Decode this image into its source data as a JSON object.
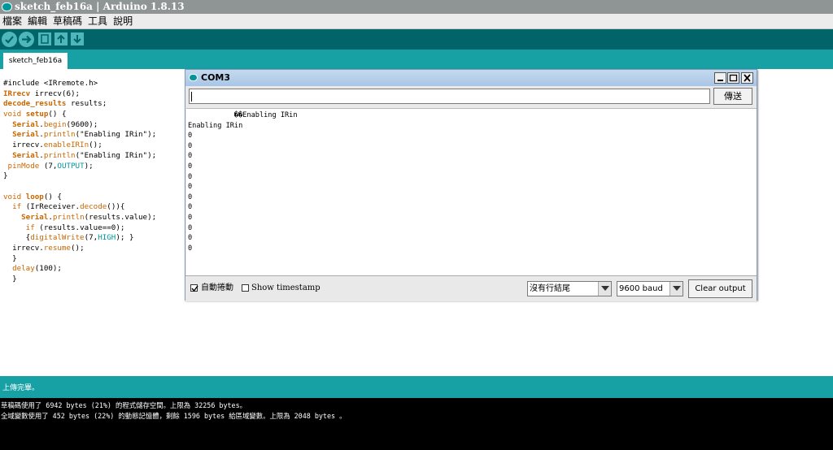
{
  "window": {
    "title": "sketch_feb16a | Arduino 1.8.13"
  },
  "menu": {
    "items": [
      "檔案",
      "編輯",
      "草稿碼",
      "工具",
      "說明"
    ]
  },
  "tab": {
    "label": "sketch_feb16a"
  },
  "code": {
    "lines": [
      [
        {
          "t": "#include <IRremote.h>",
          "c": ""
        }
      ],
      [
        {
          "t": "IRrecv",
          "c": "kwb"
        },
        {
          "t": " irrecv(6);",
          "c": ""
        }
      ],
      [
        {
          "t": "decode_results",
          "c": "kwb"
        },
        {
          "t": " results;",
          "c": ""
        }
      ],
      [
        {
          "t": "void",
          "c": "ty"
        },
        {
          "t": " ",
          "c": ""
        },
        {
          "t": "setup",
          "c": "kwb"
        },
        {
          "t": "() {",
          "c": ""
        }
      ],
      [
        {
          "t": "  ",
          "c": ""
        },
        {
          "t": "Serial",
          "c": "kwb"
        },
        {
          "t": ".",
          "c": ""
        },
        {
          "t": "begin",
          "c": "kw"
        },
        {
          "t": "(9600);",
          "c": ""
        }
      ],
      [
        {
          "t": "  ",
          "c": ""
        },
        {
          "t": "Serial",
          "c": "kwb"
        },
        {
          "t": ".",
          "c": ""
        },
        {
          "t": "println",
          "c": "kw"
        },
        {
          "t": "(\"Enabling IRin\");",
          "c": ""
        }
      ],
      [
        {
          "t": "  irrecv.",
          "c": ""
        },
        {
          "t": "enableIRIn",
          "c": "kw"
        },
        {
          "t": "();",
          "c": ""
        }
      ],
      [
        {
          "t": "  ",
          "c": ""
        },
        {
          "t": "Serial",
          "c": "kwb"
        },
        {
          "t": ".",
          "c": ""
        },
        {
          "t": "println",
          "c": "kw"
        },
        {
          "t": "(\"Enabling IRin\");",
          "c": ""
        }
      ],
      [
        {
          "t": " ",
          "c": ""
        },
        {
          "t": "pinMode",
          "c": "kw"
        },
        {
          "t": " (7,",
          "c": ""
        },
        {
          "t": "OUTPUT",
          "c": "cst"
        },
        {
          "t": ");",
          "c": ""
        }
      ],
      [
        {
          "t": "}",
          "c": ""
        }
      ],
      [
        {
          "t": "",
          "c": ""
        }
      ],
      [
        {
          "t": "void",
          "c": "ty"
        },
        {
          "t": " ",
          "c": ""
        },
        {
          "t": "loop",
          "c": "kwb"
        },
        {
          "t": "() {",
          "c": ""
        }
      ],
      [
        {
          "t": "  ",
          "c": ""
        },
        {
          "t": "if",
          "c": "kw"
        },
        {
          "t": " (IrReceiver.",
          "c": ""
        },
        {
          "t": "decode",
          "c": "kw"
        },
        {
          "t": "()){",
          "c": ""
        }
      ],
      [
        {
          "t": "    ",
          "c": ""
        },
        {
          "t": "Serial",
          "c": "kwb"
        },
        {
          "t": ".",
          "c": ""
        },
        {
          "t": "println",
          "c": "kw"
        },
        {
          "t": "(results.value);",
          "c": ""
        }
      ],
      [
        {
          "t": "     ",
          "c": ""
        },
        {
          "t": "if",
          "c": "kw"
        },
        {
          "t": " (results.value==0);",
          "c": ""
        }
      ],
      [
        {
          "t": "     {",
          "c": ""
        },
        {
          "t": "digitalWrite",
          "c": "kw"
        },
        {
          "t": "(7,",
          "c": ""
        },
        {
          "t": "HIGH",
          "c": "cst"
        },
        {
          "t": "); }",
          "c": ""
        }
      ],
      [
        {
          "t": "  irrecv.",
          "c": ""
        },
        {
          "t": "resume",
          "c": "kw"
        },
        {
          "t": "();",
          "c": ""
        }
      ],
      [
        {
          "t": "  }",
          "c": ""
        }
      ],
      [
        {
          "t": "  ",
          "c": ""
        },
        {
          "t": "delay",
          "c": "kw"
        },
        {
          "t": "(100);",
          "c": ""
        }
      ],
      [
        {
          "t": "  }",
          "c": ""
        }
      ]
    ]
  },
  "serial_monitor": {
    "title": "COM3",
    "send_label": "傳送",
    "send_value": "",
    "output_lines": [
      "           ��Enabling IRin",
      "Enabling IRin",
      "0",
      "0",
      "0",
      "0",
      "0",
      "0",
      "0",
      "0",
      "0",
      "0",
      "0",
      "0"
    ],
    "autoscroll_label": "自動捲動",
    "autoscroll_checked": true,
    "timestamp_label": "Show timestamp",
    "timestamp_checked": false,
    "line_ending": "沒有行結尾",
    "baud": "9600 baud",
    "clear_label": "Clear output"
  },
  "status": {
    "message": "上傳完畢。"
  },
  "console": {
    "lines": [
      "草稿碼使用了 6942 bytes (21%) 的程式儲存空間。上限為 32256 bytes。",
      "全域變數使用了 452 bytes (22%) 的動態記憶體，剩餘 1596 bytes 給區域變數。上限為 2048 bytes 。"
    ]
  },
  "colors": {
    "toolbar": "#006468",
    "tab_strip": "#17a1a5",
    "keyword": "#cc6600",
    "constant": "#00979c"
  }
}
